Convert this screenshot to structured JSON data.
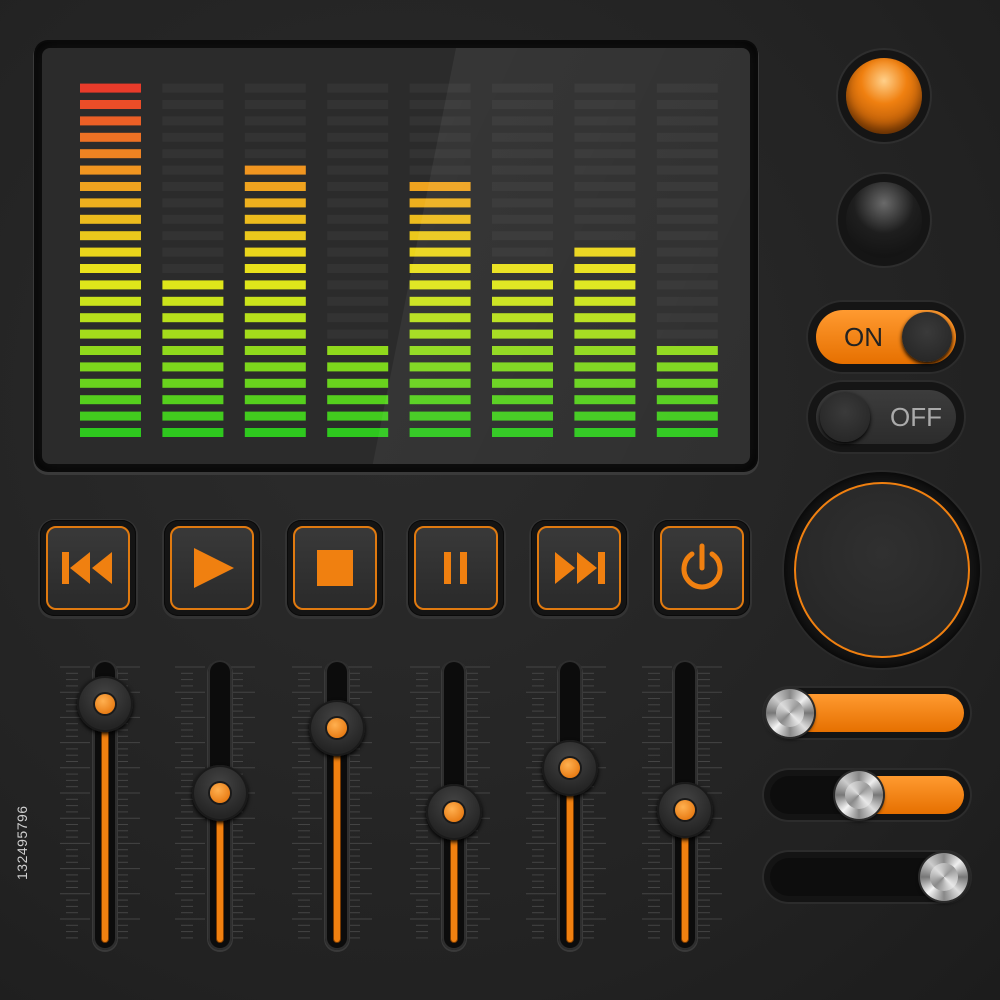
{
  "equalizer": {
    "band_levels": [
      22,
      10,
      17,
      6,
      16,
      11,
      12,
      6
    ],
    "max_level": 22,
    "colors": {
      "low": "#2ec81e",
      "mid": "#e8e81a",
      "high": "#f09a20",
      "peak": "#e83b2a",
      "unlit": "#333333"
    }
  },
  "transport": {
    "rewind_icon": "rewind-icon",
    "play_icon": "play-icon",
    "stop_icon": "stop-icon",
    "pause_icon": "pause-icon",
    "fast_forward_icon": "fast-forward-icon",
    "power_icon": "power-icon",
    "accent": "#f08010"
  },
  "sliders": {
    "levels": [
      0.93,
      0.55,
      0.83,
      0.47,
      0.66,
      0.48
    ]
  },
  "indicators": {
    "lamp_on_color": "#f08010",
    "lamp_off_color": "#1e1e1e"
  },
  "toggles": {
    "on_label": "ON",
    "off_label": "OFF"
  },
  "horizontal_sliders": {
    "levels": [
      0.0,
      0.45,
      1.0
    ]
  },
  "stock_id": "132495796"
}
